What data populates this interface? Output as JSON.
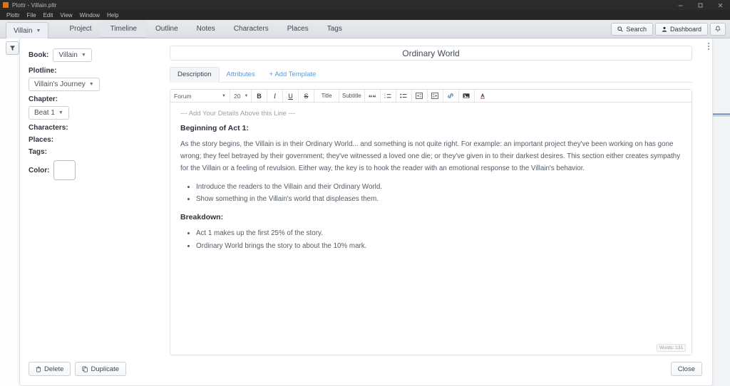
{
  "window": {
    "title": "Plottr - Villain.pltr",
    "app_icon": "plottr-logo-icon",
    "minimize_label": "─",
    "maximize_label": "□",
    "close_label": "✕"
  },
  "menubar": {
    "items": [
      {
        "label": "Plottr"
      },
      {
        "label": "File"
      },
      {
        "label": "Edit"
      },
      {
        "label": "View"
      },
      {
        "label": "Window"
      },
      {
        "label": "Help"
      }
    ]
  },
  "navbar": {
    "book_selector": "Villain",
    "tabs": [
      {
        "label": "Project",
        "active": false
      },
      {
        "label": "Timeline",
        "active": true
      },
      {
        "label": "Outline",
        "active": false
      },
      {
        "label": "Notes",
        "active": false
      },
      {
        "label": "Characters",
        "active": false
      },
      {
        "label": "Places",
        "active": false
      },
      {
        "label": "Tags",
        "active": false
      }
    ],
    "search_label": "Search",
    "dashboard_label": "Dashboard",
    "bell_icon": "bell-icon"
  },
  "sidebar": {
    "filter_icon": "filter-funnel-icon"
  },
  "meta": {
    "book_label": "Book:",
    "book_value": "Villain",
    "plotline_label": "Plotline:",
    "plotline_value": "Villain's Journey",
    "chapter_label": "Chapter:",
    "chapter_value": "Beat 1",
    "characters_label": "Characters:",
    "places_label": "Places:",
    "tags_label": "Tags:",
    "color_label": "Color:",
    "color_value": "#ffffff"
  },
  "card": {
    "title": "Ordinary World",
    "kebab_icon": "vertical-dots-icon",
    "tabs": [
      {
        "label": "Description",
        "active": true
      },
      {
        "label": "Attributes",
        "active": false
      },
      {
        "label": "+ Add Template",
        "active": false
      }
    ]
  },
  "toolbar": {
    "font_family": "Forum",
    "font_size": "20",
    "bold": "B",
    "italic": "I",
    "underline": "U",
    "strikethrough": "S",
    "title_label": "Title",
    "subtitle_label": "Subtitle",
    "blockquote": "“",
    "ordered_list_icon": "ordered-list-icon",
    "bullet_list_icon": "bullet-list-icon",
    "outdent_icon": "outdent-icon",
    "indent_icon": "indent-icon",
    "link_icon": "link-icon",
    "image_icon": "image-icon",
    "text_color_icon": "text-color-icon"
  },
  "document": {
    "hint": "--- Add Your Details Above this Line ---",
    "heading_1": "Beginning of Act 1:",
    "paragraph_1": "As the story begins, the Villain is in their Ordinary World... and something is not quite right. For example: an important project they've been working on has gone wrong; they feel betrayed by their government; they've witnessed a loved one die; or they've given in to their darkest desires. This section either creates sympathy for the Villain or a feeling of revulsion. Either way, the key is to hook the reader with an emotional response to the Villain's behavior.",
    "list_1": [
      "Introduce the readers to the Villain and their Ordinary World.",
      "Show something in the Villain's world that displeases them."
    ],
    "heading_2": "Breakdown:",
    "list_2": [
      "Act 1 makes up the first 25% of the story.",
      "Ordinary World brings the story to about the 10% mark."
    ],
    "word_count": "Words: 131"
  },
  "footer": {
    "delete_label": "Delete",
    "delete_icon": "trash-icon",
    "duplicate_label": "Duplicate",
    "duplicate_icon": "copy-icon",
    "close_label": "Close"
  },
  "colors": {
    "accent_blue": "#5b9bd5",
    "titlebar_bg": "#2b2b2b",
    "nav_bg": "#dcdfe4",
    "text_body": "#555c66"
  }
}
